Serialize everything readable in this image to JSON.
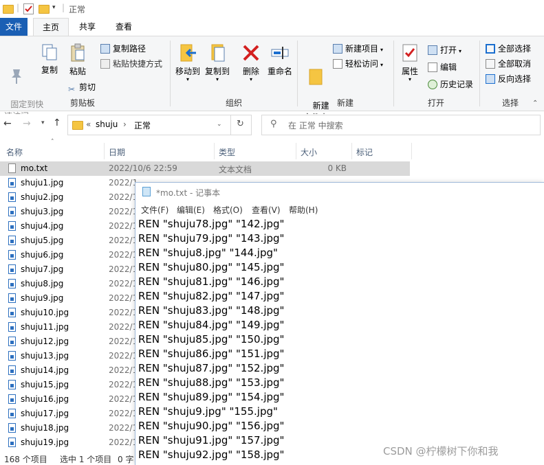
{
  "window": {
    "title": "正常",
    "quick_access": [
      "folder-icon",
      "properties-check-icon",
      "new-folder-icon"
    ]
  },
  "ribbon_tabs": [
    {
      "label": "文件"
    },
    {
      "label": "主页"
    },
    {
      "label": "共享"
    },
    {
      "label": "查看"
    }
  ],
  "ribbon": {
    "clipboard": {
      "pin_label": "固定到快\n速访问",
      "copy_label": "复制",
      "paste_label": "粘贴",
      "copy_path_label": "复制路径",
      "paste_shortcut_label": "粘贴快捷方式",
      "cut_label": "剪切",
      "group_label": "剪贴板"
    },
    "organize": {
      "move_to_label": "移动到",
      "copy_to_label": "复制到",
      "delete_label": "删除",
      "rename_label": "重命名",
      "group_label": "组织"
    },
    "new": {
      "new_folder_label": "新建\n文件夹",
      "new_item_label": "新建项目",
      "easy_access_label": "轻松访问",
      "group_label": "新建"
    },
    "open": {
      "properties_label": "属性",
      "open_label": "打开",
      "edit_label": "编辑",
      "history_label": "历史记录",
      "group_label": "打开"
    },
    "select": {
      "select_all_label": "全部选择",
      "select_none_label": "全部取消",
      "invert_label": "反向选择",
      "group_label": "选择"
    }
  },
  "address": {
    "prefix": "«",
    "crumb1": "shuju",
    "crumb2": "正常",
    "search_placeholder": "在 正常 中搜索"
  },
  "columns": {
    "name": "名称",
    "date": "日期",
    "type": "类型",
    "size": "大小",
    "tags": "标记"
  },
  "files": [
    {
      "name": "mo.txt",
      "date": "2022/10/6 22:59",
      "type": "文本文档",
      "size": "0 KB",
      "selected": true,
      "kind": "txt"
    },
    {
      "name": "shuju1.jpg",
      "date": "2022/1",
      "kind": "jpg"
    },
    {
      "name": "shuju2.jpg",
      "date": "2022/1",
      "kind": "jpg"
    },
    {
      "name": "shuju3.jpg",
      "date": "2022/1",
      "kind": "jpg"
    },
    {
      "name": "shuju4.jpg",
      "date": "2022/1",
      "kind": "jpg"
    },
    {
      "name": "shuju5.jpg",
      "date": "2022/1",
      "kind": "jpg"
    },
    {
      "name": "shuju6.jpg",
      "date": "2022/1",
      "kind": "jpg"
    },
    {
      "name": "shuju7.jpg",
      "date": "2022/1",
      "kind": "jpg"
    },
    {
      "name": "shuju8.jpg",
      "date": "2022/1",
      "kind": "jpg"
    },
    {
      "name": "shuju9.jpg",
      "date": "2022/1",
      "kind": "jpg"
    },
    {
      "name": "shuju10.jpg",
      "date": "2022/1",
      "kind": "jpg"
    },
    {
      "name": "shuju11.jpg",
      "date": "2022/1",
      "kind": "jpg"
    },
    {
      "name": "shuju12.jpg",
      "date": "2022/1",
      "kind": "jpg"
    },
    {
      "name": "shuju13.jpg",
      "date": "2022/1",
      "kind": "jpg"
    },
    {
      "name": "shuju14.jpg",
      "date": "2022/1",
      "kind": "jpg"
    },
    {
      "name": "shuju15.jpg",
      "date": "2022/1",
      "kind": "jpg"
    },
    {
      "name": "shuju16.jpg",
      "date": "2022/1",
      "kind": "jpg"
    },
    {
      "name": "shuju17.jpg",
      "date": "2022/1",
      "kind": "jpg"
    },
    {
      "name": "shuju18.jpg",
      "date": "2022/1",
      "kind": "jpg"
    },
    {
      "name": "shuju19.jpg",
      "date": "2022/1",
      "kind": "jpg"
    }
  ],
  "status": {
    "count": "168 个项目",
    "selected": "选中 1 个项目",
    "size": "0 字"
  },
  "notepad": {
    "title": "*mo.txt - 记事本",
    "menu": [
      "文件(F)",
      "编辑(E)",
      "格式(O)",
      "查看(V)",
      "帮助(H)"
    ],
    "lines": [
      "REN \"shuju78.jpg\" \"142.jpg\"",
      "REN \"shuju79.jpg\" \"143.jpg\"",
      "REN \"shuju8.jpg\" \"144.jpg\"",
      "REN \"shuju80.jpg\" \"145.jpg\"",
      "REN \"shuju81.jpg\" \"146.jpg\"",
      "REN \"shuju82.jpg\" \"147.jpg\"",
      "REN \"shuju83.jpg\" \"148.jpg\"",
      "REN \"shuju84.jpg\" \"149.jpg\"",
      "REN \"shuju85.jpg\" \"150.jpg\"",
      "REN \"shuju86.jpg\" \"151.jpg\"",
      "REN \"shuju87.jpg\" \"152.jpg\"",
      "REN \"shuju88.jpg\" \"153.jpg\"",
      "REN \"shuju89.jpg\" \"154.jpg\"",
      "REN \"shuju9.jpg\" \"155.jpg\"",
      "REN \"shuju90.jpg\" \"156.jpg\"",
      "REN \"shuju91.jpg\" \"157.jpg\"",
      "REN \"shuju92.jpg\" \"158.jpg\""
    ]
  },
  "watermark": "CSDN @柠檬树下你和我",
  "colors": {
    "accent": "#1a5fb4",
    "selection": "#d9d9d9",
    "column_header": "#4c607a",
    "delete_red": "#d32020"
  }
}
